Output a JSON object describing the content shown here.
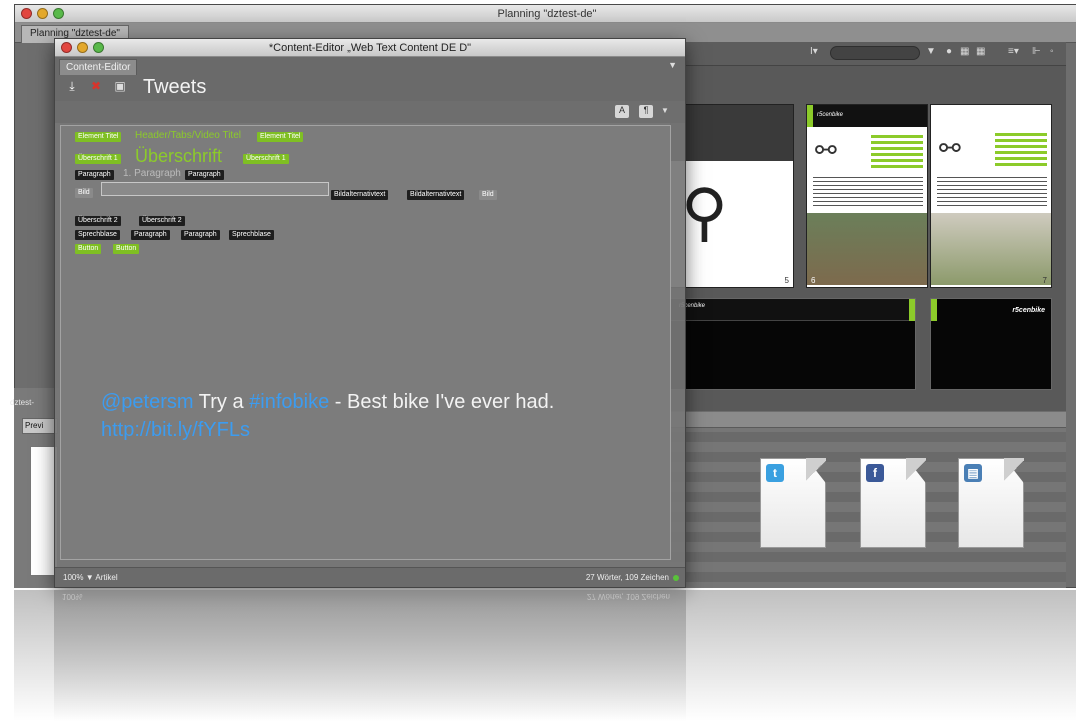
{
  "background_window": {
    "title": "Planning \"dztest-de\"",
    "tab_label": "Planning \"dztest-de\"",
    "left_panel_label": "dztest-",
    "left_panel_tab": "Previ",
    "toolbar_icons": [
      "text-tool-icon",
      "view-toggle-icon",
      "grid-icon",
      "sort-icon"
    ]
  },
  "pages": [
    {
      "number": "5",
      "brand": ""
    },
    {
      "number": "6",
      "brand": "r5cenbike"
    },
    {
      "number": "7",
      "brand": ""
    },
    {
      "number": "",
      "brand": "r5cenbike"
    },
    {
      "number": "",
      "brand": "r5cenbike"
    }
  ],
  "assets": {
    "files": [
      {
        "name": "twitter-file",
        "glyph": "t",
        "color": "#3aa0e0"
      },
      {
        "name": "facebook-file",
        "glyph": "f",
        "color": "#3b5998"
      },
      {
        "name": "video-file",
        "glyph": "▤",
        "color": "#4a7fb5"
      }
    ]
  },
  "editor": {
    "title": "*Content-Editor „Web Text Content DE D\"",
    "tab_label": "Content-Editor",
    "heading": "Tweets",
    "tags": {
      "element_titel": "Element Titel",
      "header_tabs": "Header/Tabs/Video Titel",
      "ueberschrift_1": "Überschrift 1",
      "ueberschrift_text": "Überschrift",
      "paragraph": "Paragraph",
      "paragraph_text": "1. Paragraph",
      "bild": "Bild",
      "bildalternativtext": "Bildalternativtext",
      "ueberschrift_2": "Überschrift 2",
      "sprechblase": "Sprechblase",
      "button": "Button"
    },
    "tweet": {
      "handle": "@petersm",
      "text_1": "Try a",
      "hashtag": "#infobike",
      "text_2": "- Best bike I've ever had.",
      "link": "http://bit.ly/fYFLs"
    },
    "status": {
      "zoom": "100%",
      "type": "Artikel",
      "counts": "27 Wörter, 109 Zeichen"
    }
  },
  "colors": {
    "tag_green": "#7fbf23",
    "tweet_blue": "#3c9cf0",
    "status_ok": "#59c23a"
  }
}
